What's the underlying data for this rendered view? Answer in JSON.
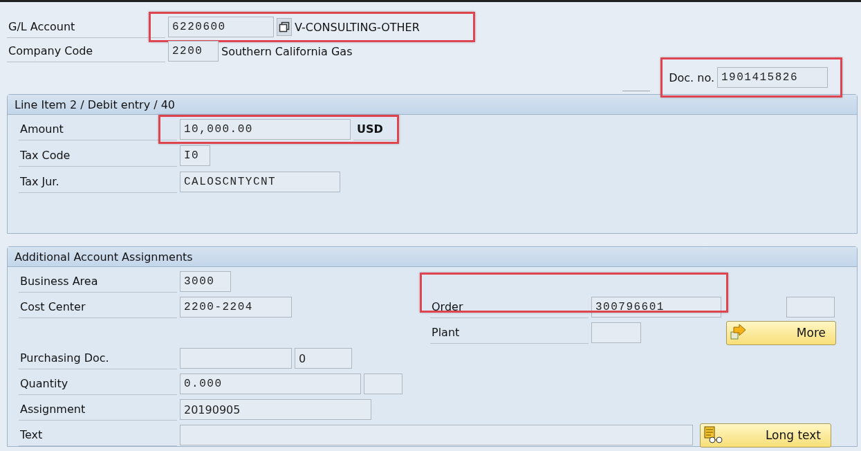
{
  "header": {
    "rows": [
      {
        "label": "G/L Account",
        "value": "6220600",
        "description": "V-CONSULTING-OTHER",
        "highlighted": true
      },
      {
        "label": "Company Code",
        "value": "2200",
        "description": "Southern California Gas",
        "highlighted": false
      }
    ],
    "doc_no": {
      "label": "Doc. no.",
      "value": "1901415826",
      "highlighted": true
    }
  },
  "line_item": {
    "title": "Line Item 2 / Debit entry / 40",
    "rows": [
      {
        "label": "Amount",
        "value": "10,000.00",
        "unit": "USD",
        "highlighted": true
      },
      {
        "label": "Tax Code",
        "value": "I0",
        "highlighted": false
      },
      {
        "label": "Tax Jur.",
        "value": "CALOSCNTYCNT",
        "highlighted": false
      }
    ]
  },
  "assignments": {
    "title": "Additional Account Assignments",
    "left_rows": [
      {
        "label": "Business Area",
        "fields": [
          {
            "value": "3000"
          }
        ]
      },
      {
        "label": "Cost Center",
        "fields": [
          {
            "value": "2200-2204"
          }
        ]
      },
      {
        "label": "Purchasing Doc.",
        "fields": [
          {
            "kind": "blank"
          },
          {
            "value": "0"
          }
        ]
      },
      {
        "label": "Quantity",
        "fields": [
          {
            "value": "0.000"
          },
          {
            "kind": "blank"
          }
        ]
      },
      {
        "label": "Assignment",
        "fields": [
          {
            "value": "20190905"
          }
        ]
      }
    ],
    "right_rows": [
      {
        "label": "Order",
        "fields": [
          {
            "value": "300796601"
          }
        ],
        "highlighted": true
      },
      {
        "label": "Plant",
        "fields": [
          {
            "kind": "blank"
          }
        ],
        "highlighted": false
      }
    ],
    "more_button": "More",
    "text_row": {
      "label": "Text",
      "button": "Long text"
    }
  }
}
